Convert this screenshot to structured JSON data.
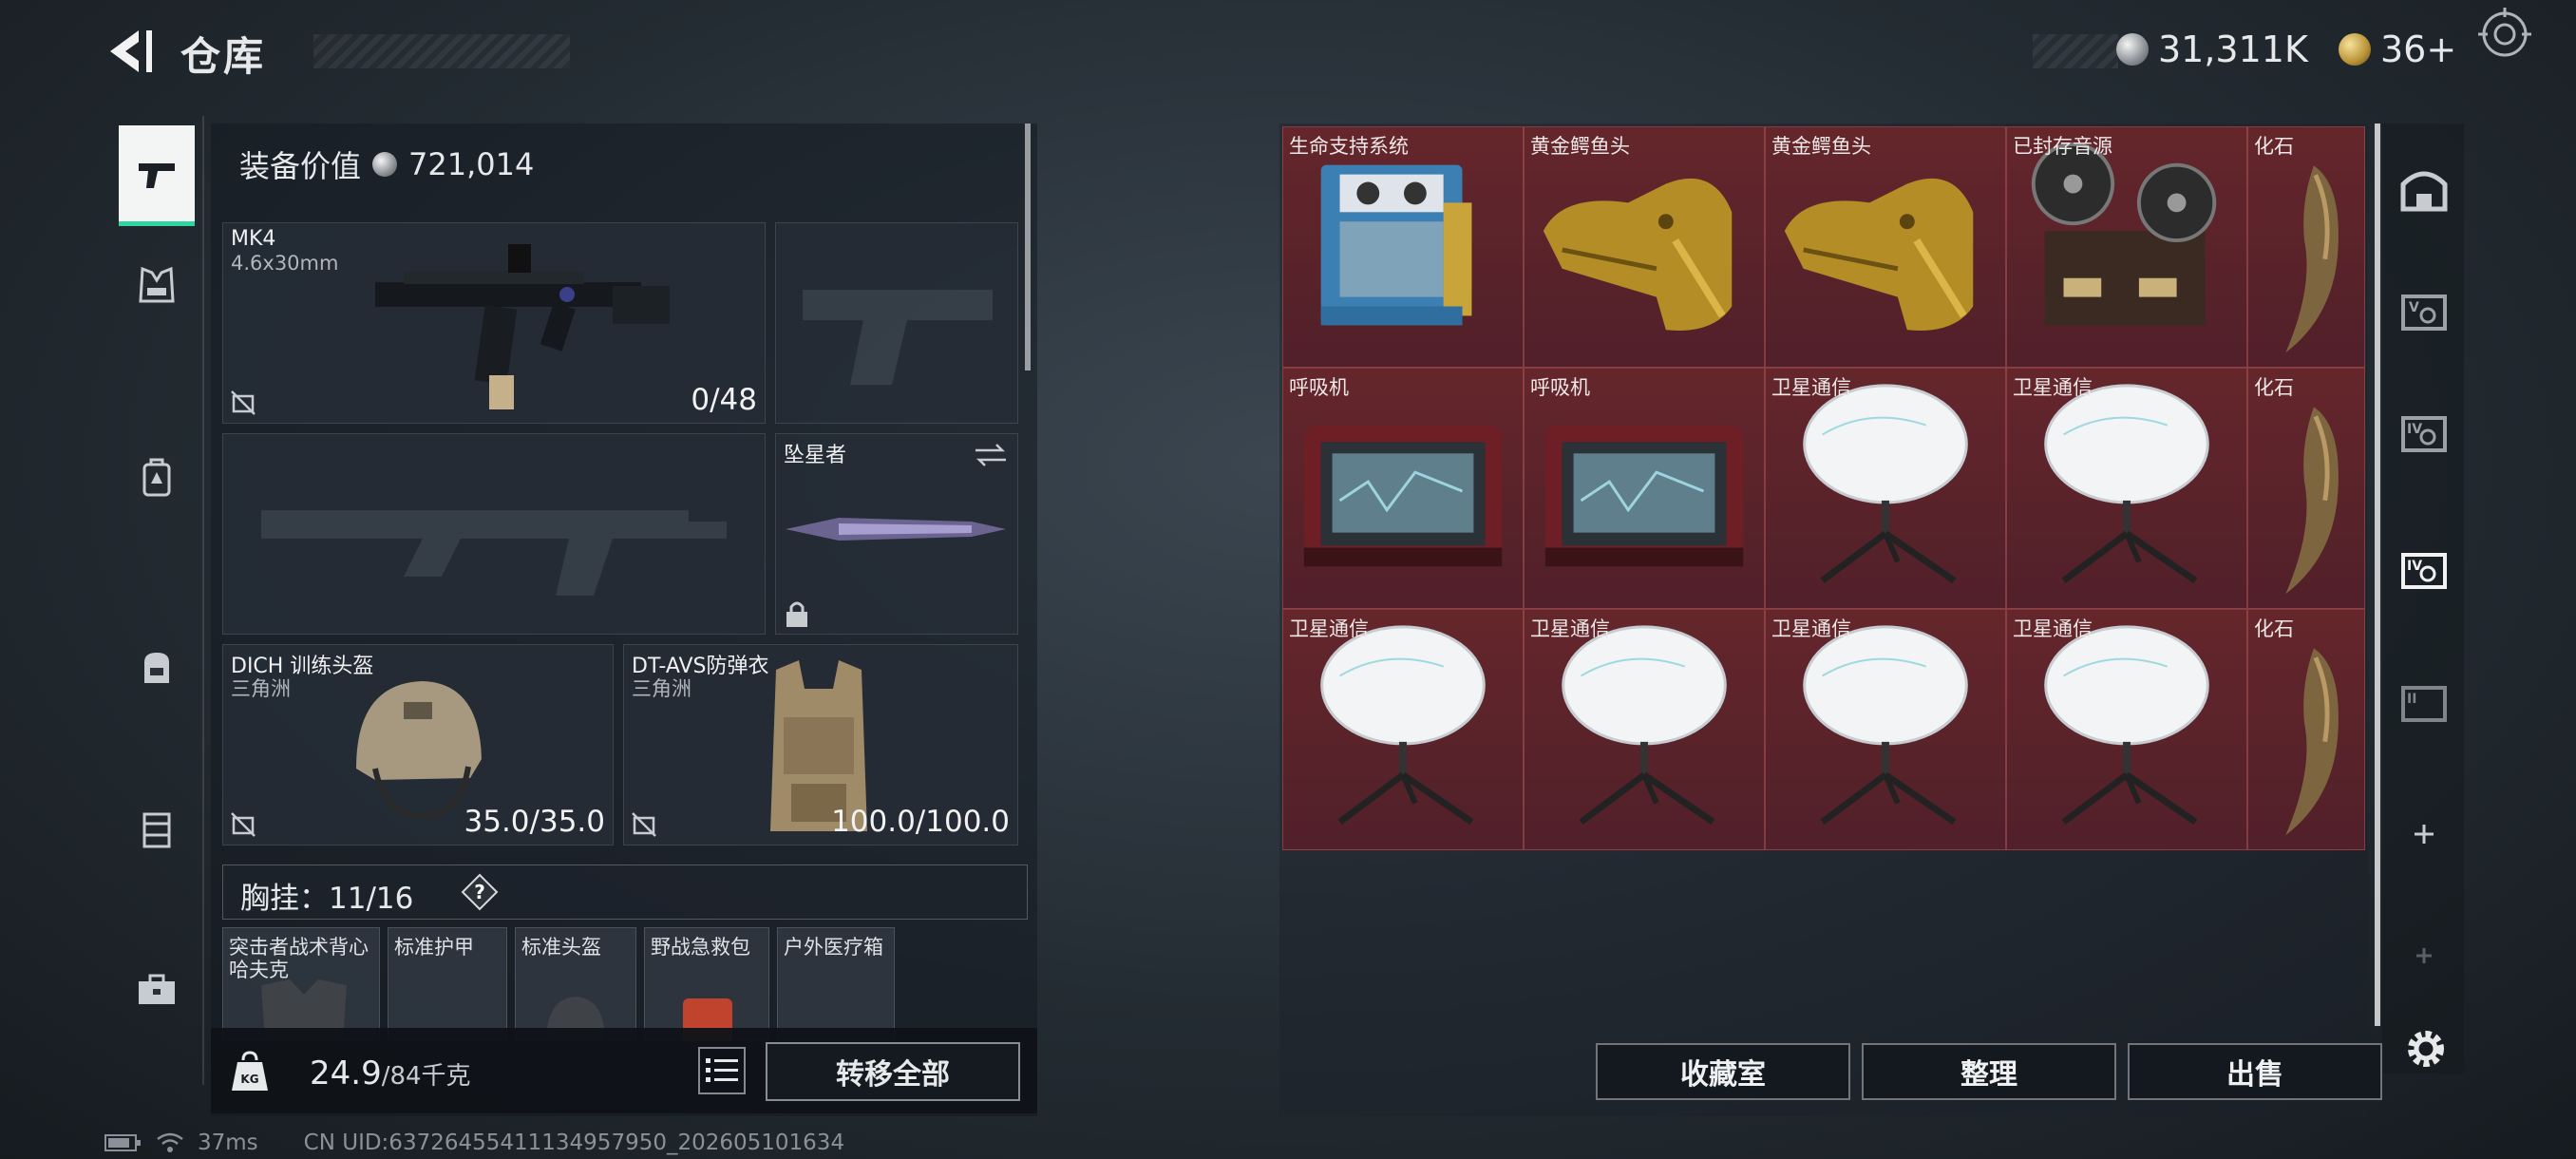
{
  "header": {
    "title": "仓库"
  },
  "currency": {
    "silver": "31,311K",
    "gold": "36+"
  },
  "left_nav": {
    "items": [
      {
        "name": "weapon"
      },
      {
        "name": "armor"
      },
      {
        "name": "backpack"
      },
      {
        "name": "bag"
      },
      {
        "name": "container"
      },
      {
        "name": "toolbox"
      }
    ]
  },
  "loadout": {
    "equip_value_label": "装备价值",
    "equip_value": "721,014",
    "primary_weapon": {
      "name": "MK4",
      "caliber": "4.6x30mm",
      "ammo": "0/48"
    },
    "melee": {
      "name": "坠星者"
    },
    "helmet": {
      "name": "DICH 训练头盔",
      "map": "三角洲",
      "durability": "35.0/35.0"
    },
    "armor": {
      "name": "DT-AVS防弹衣",
      "map": "三角洲",
      "durability": "100.0/100.0"
    },
    "chest_rig": {
      "label": "胸挂：",
      "capacity": "11/16"
    },
    "chest_items": [
      {
        "label": "突击者战术背心",
        "label2": "哈夫克"
      },
      {
        "label": "标准护甲"
      },
      {
        "label": "标准头盔"
      },
      {
        "label": "野战急救包"
      },
      {
        "label": "户外医疗箱"
      }
    ]
  },
  "bottom_bar": {
    "weight": "24.9",
    "weight_max": "/84千克",
    "transfer_all": "转移全部"
  },
  "stash": {
    "rows": [
      [
        {
          "label": "生命支持系统",
          "icon": "life-support-system"
        },
        {
          "label": "黄金鳄鱼头",
          "icon": "golden-crocodile-head"
        },
        {
          "label": "黄金鳄鱼头",
          "icon": "golden-crocodile-head"
        },
        {
          "label": "已封存音源",
          "icon": "reel-to-reel-recorder"
        },
        {
          "label": "化石",
          "icon": "fossil-claw"
        }
      ],
      [
        {
          "label": "呼吸机",
          "icon": "ventilator"
        },
        {
          "label": "呼吸机",
          "icon": "ventilator"
        },
        {
          "label": "卫星通信",
          "icon": "satellite-dish"
        },
        {
          "label": "卫星通信",
          "icon": "satellite-dish"
        },
        {
          "label": "化石",
          "icon": "fossil-claw"
        }
      ],
      [
        {
          "label": "卫星通信",
          "icon": "satellite-dish"
        },
        {
          "label": "卫星通信",
          "icon": "satellite-dish"
        },
        {
          "label": "卫星通信",
          "icon": "satellite-dish"
        },
        {
          "label": "卫星通信",
          "icon": "satellite-dish"
        },
        {
          "label": "化石",
          "icon": "fossil-claw"
        }
      ]
    ],
    "cell_color": "#5a2329"
  },
  "stash_buttons": {
    "collection": "收藏室",
    "sort": "整理",
    "sell": "出售"
  },
  "status": {
    "ping": "37ms",
    "uid": "CN UID:6372645541113495795​0_202605101634"
  },
  "colors": {
    "accent": "#2fd4a0",
    "rare_bg": "#5a2329"
  }
}
